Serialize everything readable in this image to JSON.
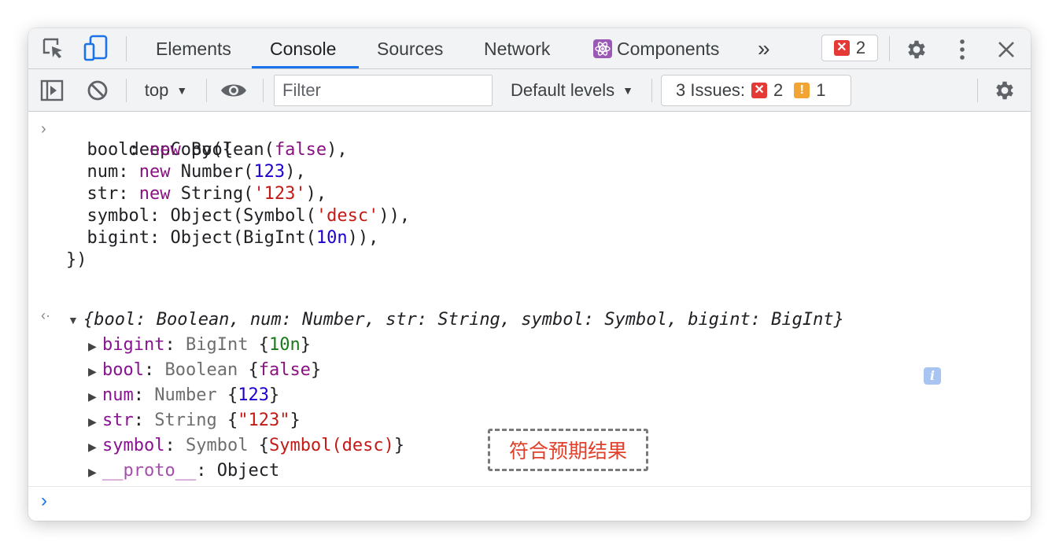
{
  "tabs": {
    "elements": "Elements",
    "console": "Console",
    "sources": "Sources",
    "network": "Network",
    "components": "Components",
    "more": "»"
  },
  "error_count": "2",
  "toolbar": {
    "context": "top",
    "filter_placeholder": "Filter",
    "levels": "Default levels",
    "issues_label": "3 Issues:",
    "issues_errors": "2",
    "issues_warnings": "1"
  },
  "input_code": {
    "l1": "deepCopy({",
    "l2_key": "  bool: ",
    "l2_new": "new",
    "l2_fn": " Boolean(",
    "l2_val": "false",
    "l2_end": "),",
    "l3_key": "  num: ",
    "l3_new": "new",
    "l3_fn": " Number(",
    "l3_val": "123",
    "l3_end": "),",
    "l4_key": "  str: ",
    "l4_new": "new",
    "l4_fn": " String(",
    "l4_val": "'123'",
    "l4_end": "),",
    "l5_pre": "  symbol: Object(Symbol(",
    "l5_val": "'desc'",
    "l5_end": ")),",
    "l6_pre": "  bigint: Object(BigInt(",
    "l6_val": "10n",
    "l6_end": ")),",
    "l7": "})"
  },
  "result_summary": "{bool: Boolean, num: Number, str: String, symbol: Symbol, bigint: BigInt}",
  "result_props": [
    {
      "key": "bigint",
      "type": "BigInt ",
      "open": "{",
      "val": "10n",
      "close": "}"
    },
    {
      "key": "bool",
      "type": "Boolean ",
      "open": "{",
      "val": "false",
      "close": "}"
    },
    {
      "key": "num",
      "type": "Number ",
      "open": "{",
      "val": "123",
      "close": "}"
    },
    {
      "key": "str",
      "type": "String ",
      "open": "{",
      "val": "\"123\"",
      "close": "}"
    },
    {
      "key": "symbol",
      "type": "Symbol ",
      "open": "{",
      "val": "Symbol(desc)",
      "close": "}"
    },
    {
      "key": "__proto__",
      "type": "Object",
      "open": "",
      "val": "",
      "close": ""
    }
  ],
  "annotation": "符合预期结果",
  "colors": {
    "accent": "#1a73e8",
    "error": "#e53935",
    "warning": "#f2a533",
    "annotation_text": "#e0412c"
  },
  "icons": [
    "inspect-element-icon",
    "device-toolbar-icon",
    "react-icon",
    "settings-icon",
    "kebab-menu-icon",
    "close-icon",
    "sidebar-toggle-icon",
    "clear-console-icon",
    "eye-icon",
    "info-icon"
  ]
}
